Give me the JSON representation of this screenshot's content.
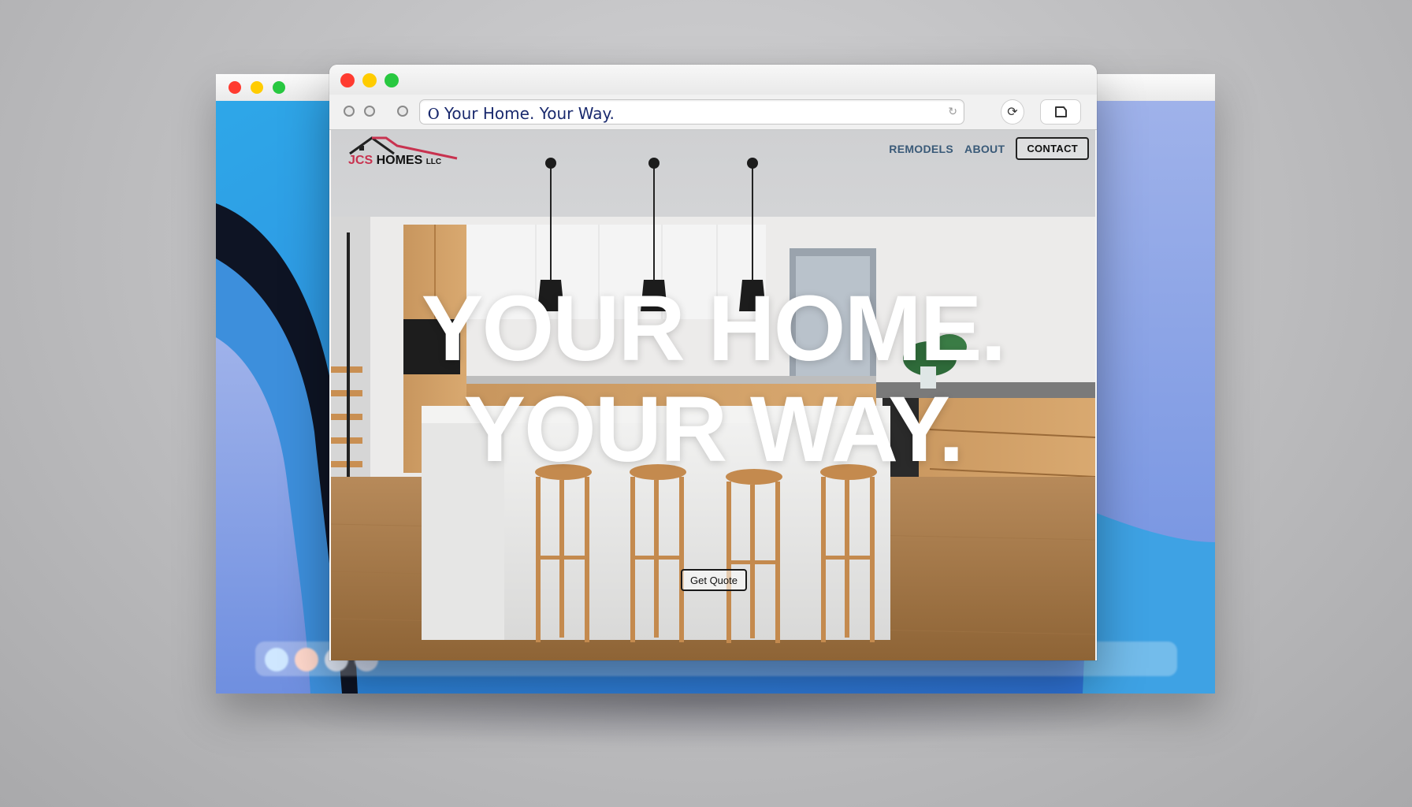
{
  "back_window": {
    "title": "",
    "traffic_lights": [
      "#ff3b30",
      "#ffcc00",
      "#28c840"
    ]
  },
  "browser": {
    "traffic_lights": [
      "#ff3b30",
      "#ffcc00",
      "#28c840"
    ],
    "address_bar": "Ⲟ Your Home. Your Way.",
    "reload_icon": "reload-icon",
    "extension_icon": "refresh-circle-icon",
    "share_icon": "tab-icon"
  },
  "site": {
    "brand": {
      "jcs": "JCS",
      "homes": "HOMES",
      "llc": "LLC",
      "accent": "#c8324f"
    },
    "nav": {
      "remodels": "REMODELS",
      "about": "ABOUT",
      "contact": "CONTACT"
    },
    "headline": {
      "line1": "YOUR HOME.",
      "line2": "YOUR WAY."
    },
    "cta": "Get Quote"
  }
}
